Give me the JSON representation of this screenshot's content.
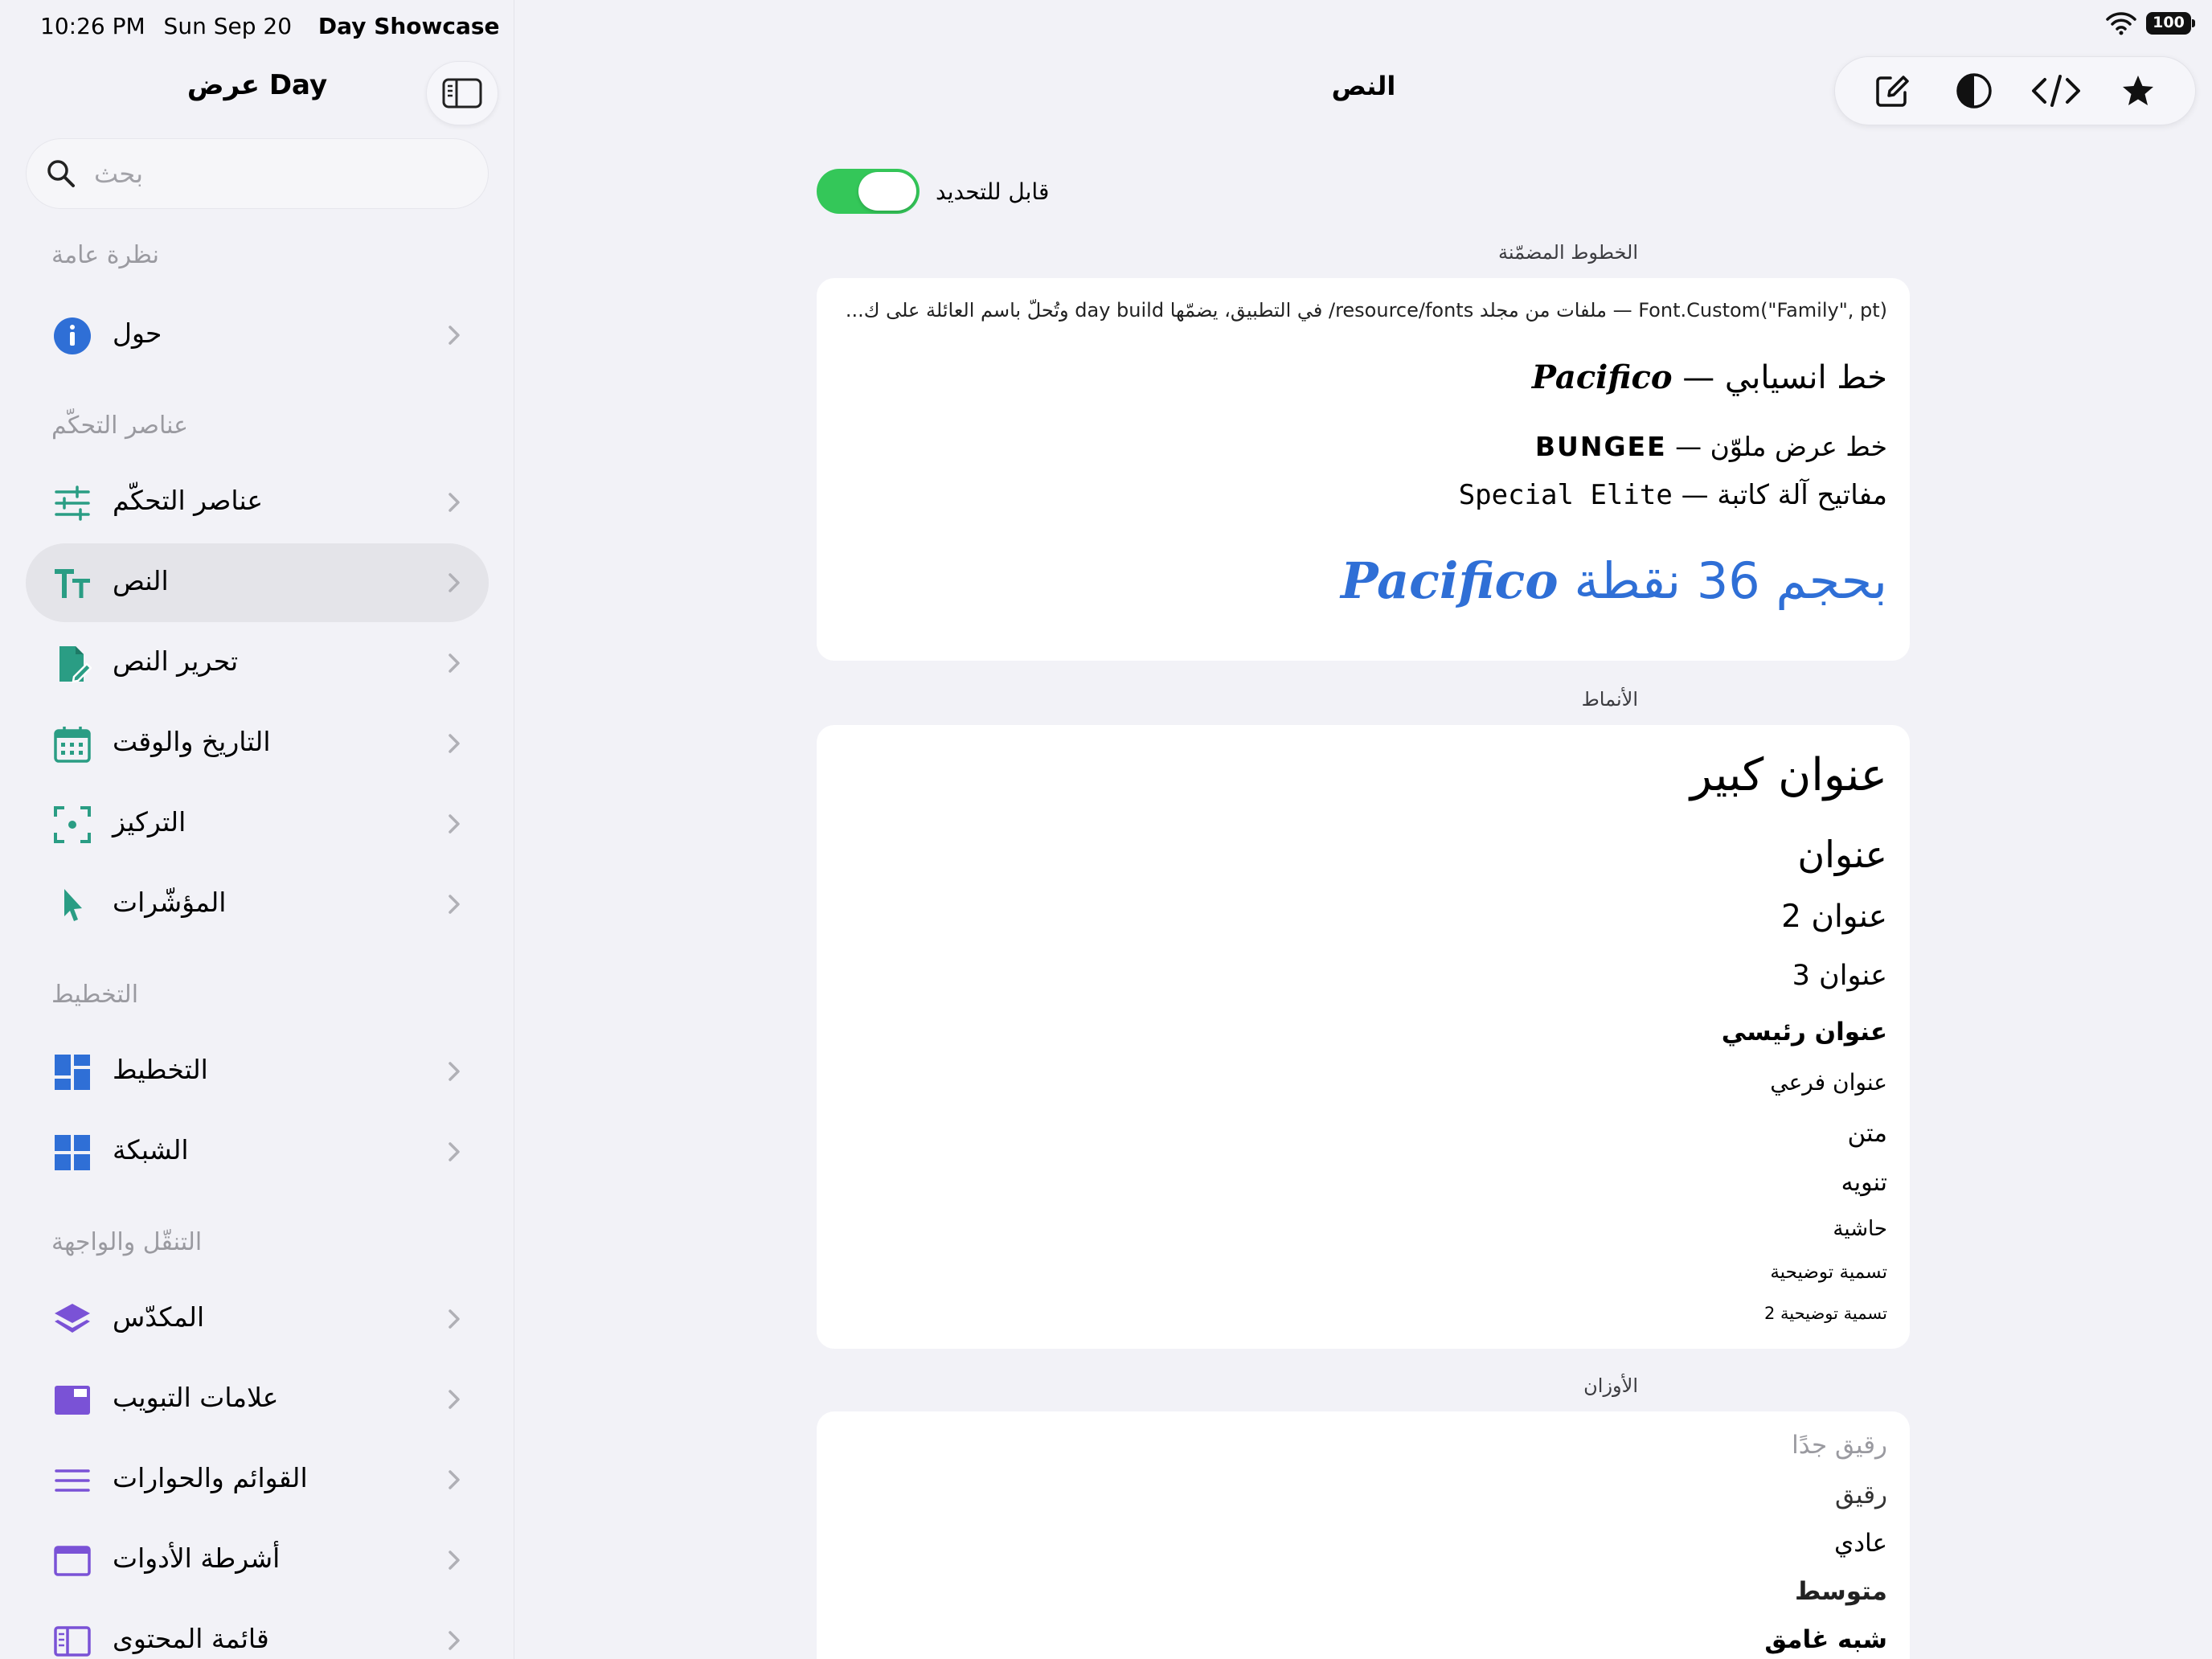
{
  "status_bar": {
    "time": "10:26 PM",
    "date": "Sun Sep 20",
    "app": "Day Showcase",
    "battery": "100"
  },
  "sidebar": {
    "title": "عرض Day",
    "search_placeholder": "بحث",
    "sections": [
      {
        "header": "نظرة عامة",
        "items": [
          {
            "label": "حول",
            "icon": "info-circle-icon"
          }
        ]
      },
      {
        "header": "عناصر التحكّم",
        "items": [
          {
            "label": "عناصر التحكّم",
            "icon": "sliders-icon"
          },
          {
            "label": "النص",
            "icon": "text-size-icon",
            "selected": true
          },
          {
            "label": "تحرير النص",
            "icon": "doc-edit-icon"
          },
          {
            "label": "التاريخ والوقت",
            "icon": "calendar-icon"
          },
          {
            "label": "التركيز",
            "icon": "focus-viewfinder-icon"
          },
          {
            "label": "المؤشّرات",
            "icon": "pointer-arrow-icon"
          }
        ]
      },
      {
        "header": "التخطيط",
        "items": [
          {
            "label": "التخطيط",
            "icon": "layout-grid-icon"
          },
          {
            "label": "الشبكة",
            "icon": "grid-icon"
          }
        ]
      },
      {
        "header": "التنقّل والواجهة",
        "items": [
          {
            "label": "المكدّس",
            "icon": "stack-layers-icon"
          },
          {
            "label": "علامات التبويب",
            "icon": "tabs-icon"
          },
          {
            "label": "القوائم والحوارات",
            "icon": "list-lines-icon"
          },
          {
            "label": "أشرطة الأدوات",
            "icon": "window-toolbar-icon"
          },
          {
            "label": "قائمة المحتوى",
            "icon": "sidebar-panel-icon"
          }
        ]
      }
    ]
  },
  "main": {
    "title": "النص",
    "toolbar_icons": [
      "compose-icon",
      "contrast-icon",
      "code-icon",
      "star-icon"
    ],
    "selectable_label": "قابل للتحديد",
    "selectable_on": true,
    "embedded_fonts": {
      "header": "الخطوط المضمّنة",
      "description": "Font.Custom(\"Family\", pt) — ملفات من مجلد resource/fonts/ في التطبيق، يضمّها day build وتُحلّ باسم العائلة على ك...",
      "pacifico_prefix": "خط انسيابي — ",
      "pacifico_name": "Pacifico",
      "bungee_prefix": "خط عرض ملوّن — ",
      "bungee_name": "BUNGEE",
      "special_prefix": "مفاتيح آلة كاتبة — ",
      "special_name": "Special Elite",
      "big_prefix": "بحجم 36 نقطة ",
      "big_name": "Pacifico",
      "accent_color": "#2f6fd6"
    },
    "styles": {
      "header": "الأنماط",
      "items": [
        "عنوان كبير",
        "عنوان",
        "عنوان 2",
        "عنوان 3",
        "عنوان رئيسي",
        "عنوان فرعي",
        "متن",
        "تنويه",
        "حاشية",
        "تسمية توضيحية",
        "تسمية توضيحية 2"
      ]
    },
    "weights": {
      "header": "الأوزان",
      "items": [
        "رقيق جدًا",
        "رقيق",
        "عادي",
        "متوسط",
        "شبه غامق"
      ]
    }
  }
}
